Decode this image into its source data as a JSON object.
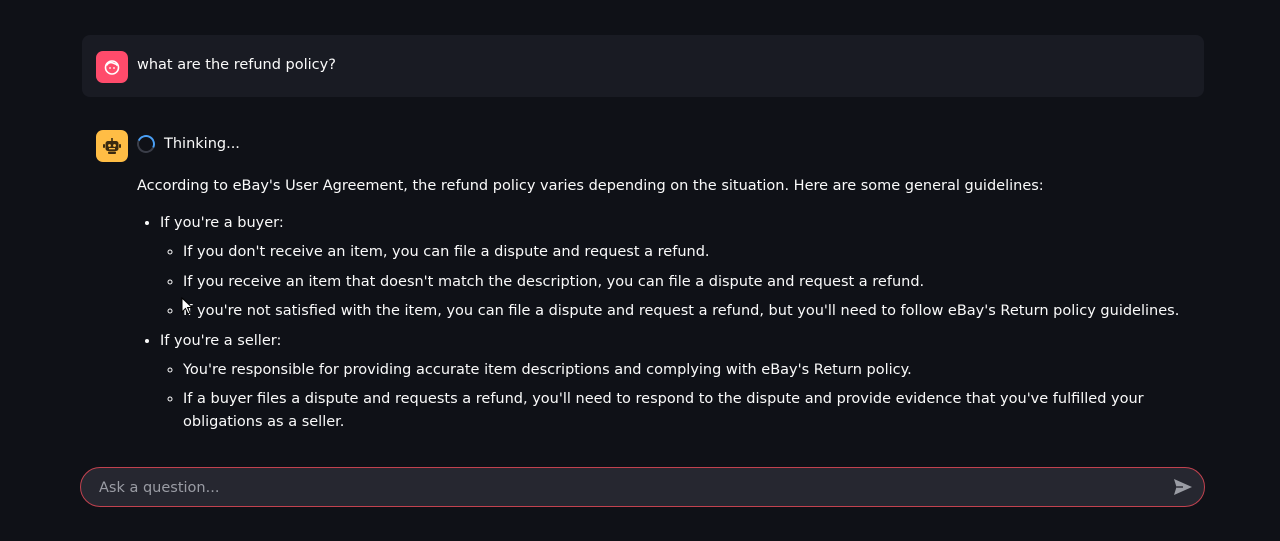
{
  "user_message": {
    "avatar_icon": "user-face-icon",
    "text": "what are the refund policy?"
  },
  "assistant": {
    "avatar_icon": "robot-icon",
    "status": "Thinking...",
    "intro": "According to eBay's User Agreement, the refund policy varies depending on the situation. Here are some general guidelines:",
    "sections": [
      {
        "label": "If you're a buyer:",
        "items": [
          "If you don't receive an item, you can file a dispute and request a refund.",
          "If you receive an item that doesn't match the description, you can file a dispute and request a refund.",
          "If you're not satisfied with the item, you can file a dispute and request a refund, but you'll need to follow eBay's Return policy guidelines."
        ]
      },
      {
        "label": "If you're a seller:",
        "items": [
          "You're responsible for providing accurate item descriptions and complying with eBay's Return policy.",
          "If a buyer files a dispute and requests a refund, you'll need to respond to the dispute and provide evidence that you've fulfilled your obligations as a seller."
        ]
      }
    ]
  },
  "chat_input": {
    "placeholder": "Ask a question...",
    "send_icon": "send-icon"
  },
  "colors": {
    "background": "#0f1117",
    "user_avatar": "#ff4b6b",
    "bot_avatar": "#ffbd45",
    "input_border": "#c2424f",
    "spinner": "#4a9ff5"
  }
}
